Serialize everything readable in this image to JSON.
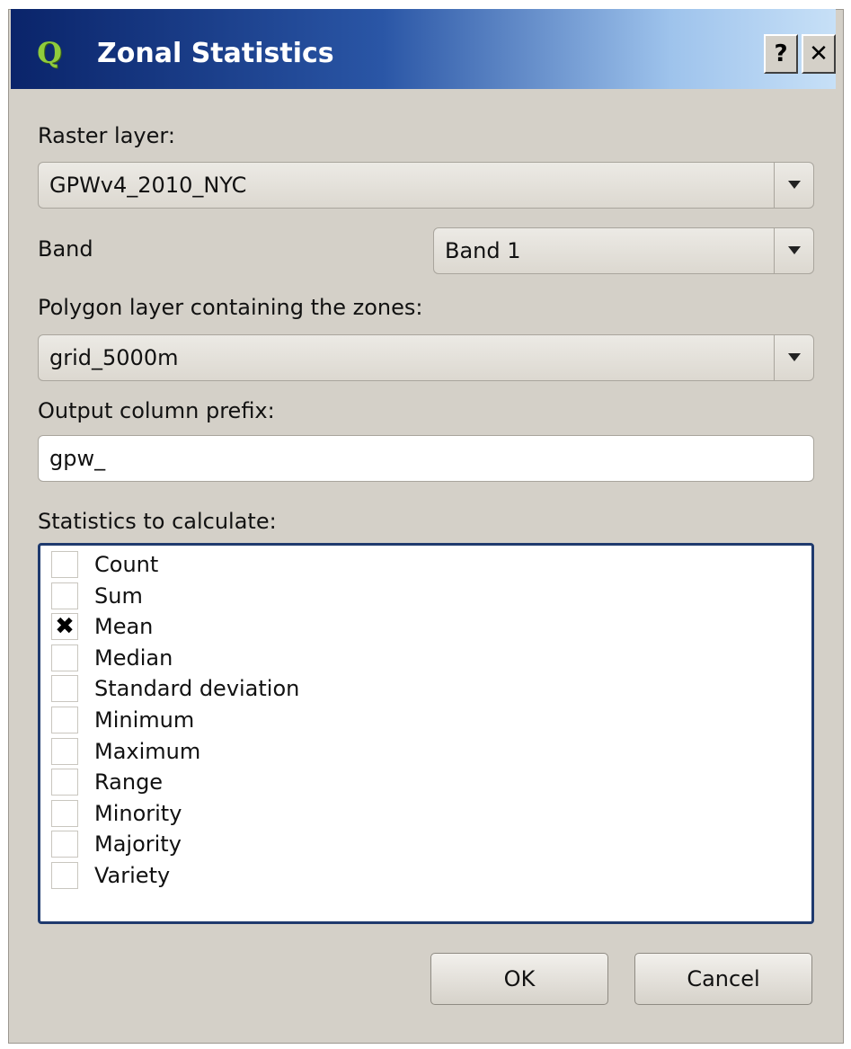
{
  "window": {
    "title": "Zonal Statistics",
    "app_icon": "qgis-q-icon",
    "help_label": "?",
    "close_label": "✕"
  },
  "raster": {
    "label": "Raster layer:",
    "value": "GPWv4_2010_NYC"
  },
  "band": {
    "label": "Band",
    "value": "Band 1"
  },
  "polygon": {
    "label": "Polygon layer containing the zones:",
    "value": "grid_5000m"
  },
  "prefix": {
    "label": "Output column prefix:",
    "value": "gpw_"
  },
  "statistics": {
    "label": "Statistics to calculate:",
    "items": [
      {
        "label": "Count",
        "checked": false
      },
      {
        "label": "Sum",
        "checked": false
      },
      {
        "label": "Mean",
        "checked": true
      },
      {
        "label": "Median",
        "checked": false
      },
      {
        "label": "Standard deviation",
        "checked": false
      },
      {
        "label": "Minimum",
        "checked": false
      },
      {
        "label": "Maximum",
        "checked": false
      },
      {
        "label": "Range",
        "checked": false
      },
      {
        "label": "Minority",
        "checked": false
      },
      {
        "label": "Majority",
        "checked": false
      },
      {
        "label": "Variety",
        "checked": false
      }
    ]
  },
  "buttons": {
    "ok": "OK",
    "cancel": "Cancel"
  },
  "colors": {
    "titlebar_start": "#0a246a",
    "titlebar_end": "#c7e0f7",
    "dialog_bg": "#d4d0c8",
    "list_border": "#1f3a6e"
  }
}
